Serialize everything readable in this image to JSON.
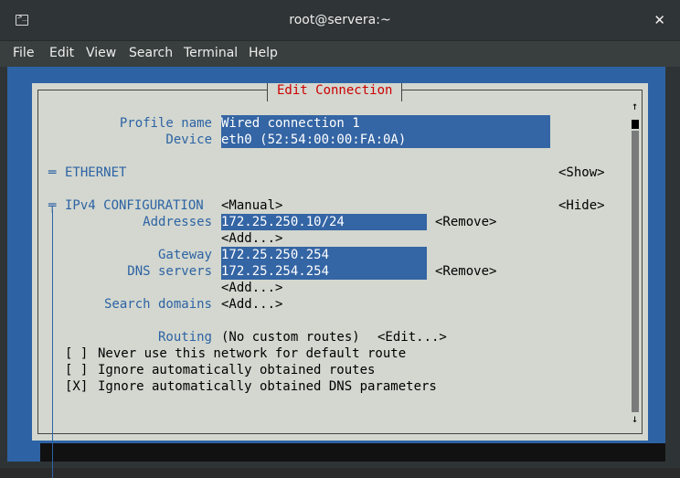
{
  "window": {
    "title": "root@servera:~",
    "close_glyph": "✕",
    "icon_glyph": ">_"
  },
  "menu": [
    "File",
    "Edit",
    "View",
    "Search",
    "Terminal",
    "Help"
  ],
  "dialog": {
    "title": "Edit Connection",
    "profile_name_label": "Profile name",
    "profile_name_value": "Wired connection 1",
    "device_label": "Device",
    "device_value": "eth0 (52:54:00:00:FA:0A)",
    "ethernet": {
      "marker": "═",
      "label": "ETHERNET",
      "action": "<Show>"
    },
    "ipv4": {
      "marker": "╤",
      "label": "IPv4 CONFIGURATION",
      "mode": "<Manual>",
      "action": "<Hide>",
      "addresses_label": "Addresses",
      "address_value": "172.25.250.10/24",
      "remove_label": "<Remove>",
      "add_label": "<Add...>",
      "gateway_label": "Gateway",
      "gateway_value": "172.25.250.254",
      "dns_label": "DNS servers",
      "dns_value": "172.25.254.254",
      "dns_remove_label": "<Remove>",
      "dns_add_label": "<Add...>",
      "search_domains_label": "Search domains",
      "search_add_label": "<Add...>",
      "routing_label": "Routing",
      "routing_value": "(No custom routes)",
      "routing_edit": "<Edit...>",
      "options": [
        {
          "check": "[ ]",
          "label": "Never use this network for default route",
          "checked": false
        },
        {
          "check": "[ ]",
          "label": "Ignore automatically obtained routes",
          "checked": false
        },
        {
          "check": "[X]",
          "label": "Ignore automatically obtained DNS parameters",
          "checked": true
        }
      ]
    },
    "scroll_up": "↑",
    "scroll_down": "↓"
  }
}
